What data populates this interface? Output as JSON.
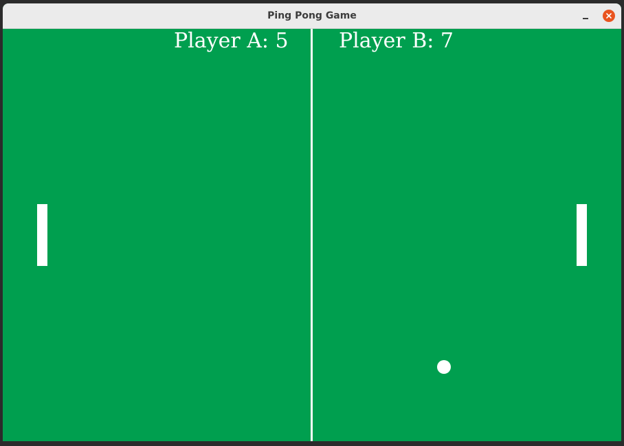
{
  "window": {
    "title": "Ping Pong Game",
    "controls": {
      "minimize_icon": "minimize-icon",
      "close_icon": "close-icon",
      "close_color": "#e9541f"
    }
  },
  "game": {
    "background_color": "#009f4f",
    "foreground_color": "#ffffff",
    "player_a": {
      "label": "Player A",
      "score": 5,
      "score_text": "Player A: 5"
    },
    "player_b": {
      "label": "Player B",
      "score": 7,
      "score_text": "Player B: 7"
    }
  }
}
